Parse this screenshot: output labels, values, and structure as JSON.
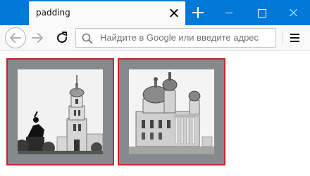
{
  "browser": {
    "tab_title": "padding",
    "url_placeholder": "Найдите в Google или введите адрес"
  },
  "content": {
    "images": [
      {
        "subject": "bell-tower-monument"
      },
      {
        "subject": "domed-church"
      }
    ]
  },
  "colors": {
    "titlebar": "#0078d7",
    "frame_border": "#c4262e",
    "frame_padding": "#868a8f"
  }
}
